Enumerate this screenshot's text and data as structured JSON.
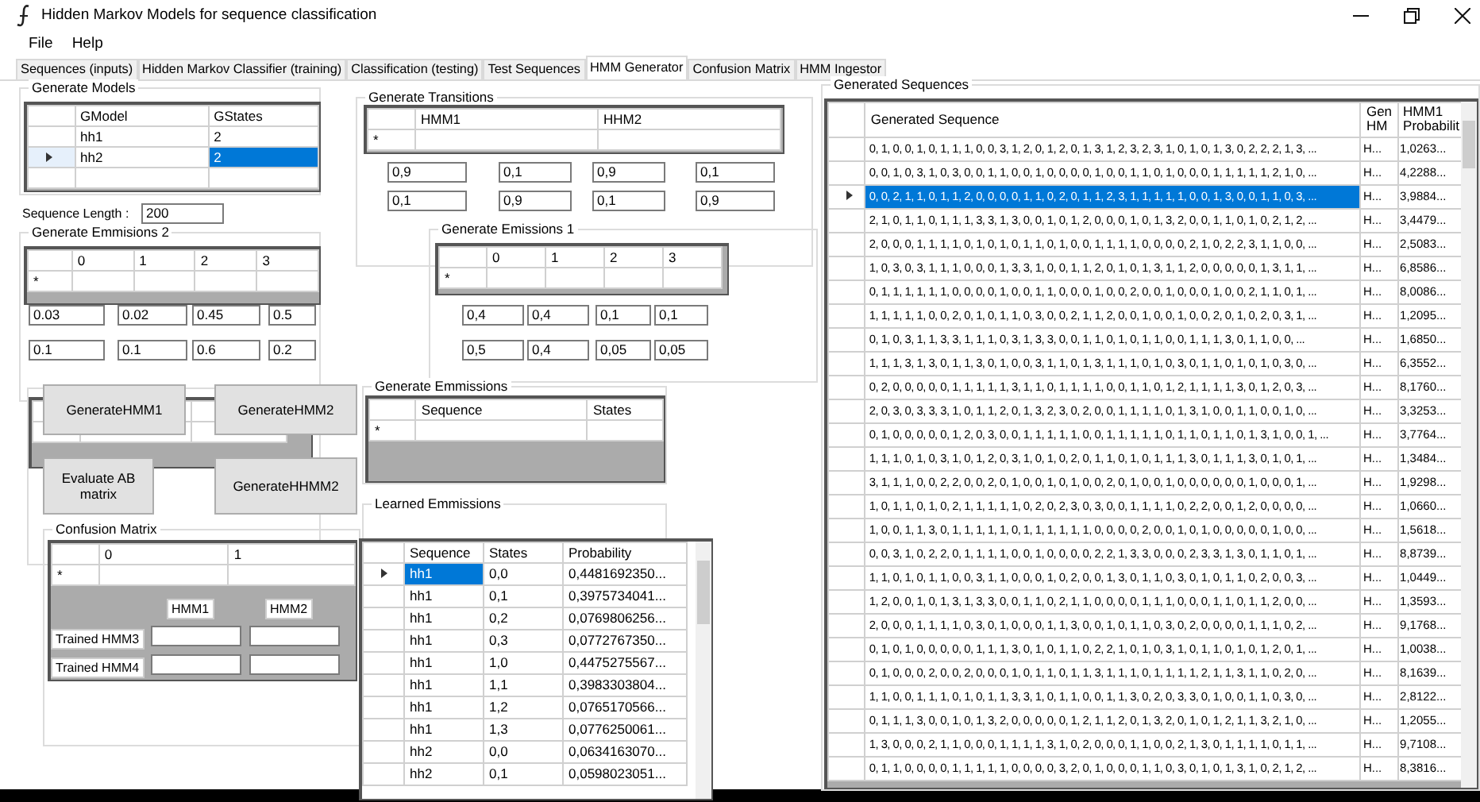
{
  "window": {
    "title": "Hidden Markov Models for sequence classification"
  },
  "menu": [
    "File",
    "Help"
  ],
  "tabs": [
    {
      "label": "Sequences (inputs)",
      "selected": false
    },
    {
      "label": "Hidden Markov Classifier (training)",
      "selected": false
    },
    {
      "label": "Classification (testing)",
      "selected": false
    },
    {
      "label": "Test Sequences",
      "selected": false
    },
    {
      "label": "HMM Generator",
      "selected": true
    },
    {
      "label": "Confusion Matrix",
      "selected": false
    },
    {
      "label": "HMM Ingestor",
      "selected": false
    }
  ],
  "generate_models": {
    "title": "Generate Models",
    "columns": [
      "GModel",
      "GStates"
    ],
    "rows": [
      {
        "cells": [
          "hh1",
          "2"
        ],
        "selected": false
      },
      {
        "cells": [
          "hh2",
          "2"
        ],
        "selected": true
      }
    ]
  },
  "sequence_length": {
    "label": "Sequence Length :",
    "value": "200"
  },
  "generate_emissions_2": {
    "title": "Generate Emmisions 2",
    "columns": [
      "0",
      "1",
      "2",
      "3"
    ],
    "new_row_marker": "*",
    "values": [
      [
        "0.03",
        "0.02",
        "0.45",
        "0.5"
      ],
      [
        "0.1",
        "0.1",
        "0.6",
        "0.2"
      ]
    ]
  },
  "generate_transitions": {
    "title": "Generate Transitions",
    "columns": [
      "HMM1",
      "HHM2"
    ],
    "new_row_marker": "*",
    "values": [
      [
        "0,9",
        "0,1",
        "0,9",
        "0,1"
      ],
      [
        "0,1",
        "0,9",
        "0,1",
        "0,9"
      ]
    ]
  },
  "generate_emissions_1": {
    "title": "Generate Emissions 1",
    "columns": [
      "0",
      "1",
      "2",
      "3"
    ],
    "new_row_marker": "*",
    "values": [
      [
        "0,4",
        "0,4",
        "0,1",
        "0,1"
      ],
      [
        "0,5",
        "0,4",
        "0,05",
        "0,05"
      ]
    ]
  },
  "buttons": [
    {
      "label": "GenerateHMM1"
    },
    {
      "label": "GenerateHMM2"
    },
    {
      "label": "Evaluate AB matrix"
    },
    {
      "label": "GenerateHHMM2"
    }
  ],
  "generate_emissions": {
    "title": "Generate Emmissions",
    "columns": [
      "Sequence",
      "States"
    ],
    "new_row_marker": "*"
  },
  "learned_emissions": {
    "title": "Learned Emmissions",
    "columns": [
      "Sequence",
      "States",
      "Probability"
    ],
    "rows": [
      {
        "cells": [
          "hh1",
          "0,0",
          "0,4481692350..."
        ],
        "selected": true
      },
      {
        "cells": [
          "hh1",
          "0,1",
          "0,3975734041..."
        ],
        "selected": false
      },
      {
        "cells": [
          "hh1",
          "0,2",
          "0,0769806256..."
        ],
        "selected": false
      },
      {
        "cells": [
          "hh1",
          "0,3",
          "0,0772767350..."
        ],
        "selected": false
      },
      {
        "cells": [
          "hh1",
          "1,0",
          "0,4475275567..."
        ],
        "selected": false
      },
      {
        "cells": [
          "hh1",
          "1,1",
          "0,3983303804..."
        ],
        "selected": false
      },
      {
        "cells": [
          "hh1",
          "1,2",
          "0,0765170566..."
        ],
        "selected": false
      },
      {
        "cells": [
          "hh1",
          "1,3",
          "0,0776250061..."
        ],
        "selected": false
      },
      {
        "cells": [
          "hh2",
          "0,0",
          "0,0634163070..."
        ],
        "selected": false
      },
      {
        "cells": [
          "hh2",
          "0,1",
          "0,0598023051..."
        ],
        "selected": false
      }
    ]
  },
  "confusion_matrix": {
    "title": "Confusion Matrix",
    "columns": [
      "0",
      "1"
    ],
    "new_row_marker": "*",
    "column_labels": [
      "HMM1",
      "HMM2"
    ],
    "row_labels": [
      "Trained HMM3",
      "Trained HMM4"
    ]
  },
  "generated_sequences": {
    "title": "Generated Sequences",
    "columns": [
      "Generated Sequence",
      "Gen HM",
      "HMM1 Probabilit"
    ],
    "rows": [
      {
        "sequence": "0, 1, 0, 0, 1, 0, 1, 1, 1, 0, 0, 3, 1, 2, 0, 1, 2, 0, 1, 3, 1, 2, 3, 2, 3, 1, 0, 1, 0, 1, 3, 0, 2, 2, 2, 1, 3, ...",
        "model": "H...",
        "probability": "1,0263...",
        "selected": false
      },
      {
        "sequence": "0, 0, 1, 0, 3, 1, 0, 3, 0, 0, 1, 1, 0, 0, 1, 0, 0, 0, 0, 1, 0, 0, 1, 1, 0, 1, 0, 0, 0, 1, 1, 1, 1, 1, 2, 1, 0, ...",
        "model": "H...",
        "probability": "4,2288...",
        "selected": false
      },
      {
        "sequence": "0, 0, 2, 1, 1, 0, 1, 1, 2, 0, 0, 0, 0, 1, 1, 0, 2, 0, 1, 1, 2, 3, 1, 1, 1, 1, 1, 0, 0, 1, 3, 0, 0, 1, 1, 0, 3, ...",
        "model": "H...",
        "probability": "3,9884...",
        "selected": true
      },
      {
        "sequence": "2, 1, 0, 1, 1, 0, 1, 1, 1, 3, 3, 1, 3, 0, 0, 1, 0, 1, 2, 0, 0, 0, 1, 0, 1, 3, 2, 0, 0, 1, 1, 0, 1, 0, 2, 1, 2, ...",
        "model": "H...",
        "probability": "3,4479...",
        "selected": false
      },
      {
        "sequence": "2, 0, 0, 0, 1, 1, 1, 1, 0, 1, 0, 1, 0, 1, 1, 0, 1, 0, 0, 1, 1, 1, 1, 0, 0, 0, 0, 2, 1, 0, 2, 2, 3, 1, 1, 0, 0, ...",
        "model": "H...",
        "probability": "2,5083...",
        "selected": false
      },
      {
        "sequence": "1, 0, 3, 0, 3, 1, 1, 1, 0, 0, 0, 1, 3, 3, 1, 0, 0, 1, 1, 2, 0, 1, 0, 1, 3, 1, 1, 2, 0, 0, 0, 0, 0, 1, 3, 1, 1, ...",
        "model": "H...",
        "probability": "6,8586...",
        "selected": false
      },
      {
        "sequence": "0, 1, 1, 1, 1, 1, 1, 0, 0, 0, 0, 1, 0, 0, 1, 1, 0, 0, 0, 1, 0, 0, 2, 0, 0, 1, 0, 0, 0, 1, 0, 0, 2, 1, 1, 0, 1, ...",
        "model": "H...",
        "probability": "8,0086...",
        "selected": false
      },
      {
        "sequence": "1, 1, 1, 1, 1, 0, 0, 2, 0, 1, 0, 1, 1, 0, 3, 0, 0, 2, 1, 1, 2, 0, 0, 1, 0, 0, 1, 0, 0, 2, 0, 1, 0, 2, 0, 3, 1, ...",
        "model": "H...",
        "probability": "1,2095...",
        "selected": false
      },
      {
        "sequence": "0, 1, 0, 3, 1, 1, 3, 3, 1, 1, 1, 0, 3, 1, 3, 3, 0, 0, 1, 1, 0, 1, 0, 1, 1, 0, 0, 1, 1, 1, 3, 0, 1, 1, 0, 0, ...",
        "model": "H...",
        "probability": "1,6850...",
        "selected": false
      },
      {
        "sequence": "1, 1, 1, 3, 1, 3, 0, 1, 1, 3, 0, 1, 0, 0, 3, 1, 1, 0, 1, 3, 1, 1, 1, 0, 1, 0, 3, 0, 1, 1, 0, 1, 0, 1, 0, 3, 0, ...",
        "model": "H...",
        "probability": "6,3552...",
        "selected": false
      },
      {
        "sequence": "0, 2, 0, 0, 0, 0, 0, 1, 1, 1, 1, 1, 3, 1, 1, 0, 1, 1, 1, 1, 0, 0, 1, 1, 0, 1, 2, 1, 1, 1, 1, 3, 0, 1, 2, 0, 3, ...",
        "model": "H...",
        "probability": "8,1760...",
        "selected": false
      },
      {
        "sequence": "2, 0, 3, 0, 3, 3, 3, 1, 0, 1, 1, 2, 0, 1, 3, 2, 3, 0, 2, 0, 0, 1, 1, 1, 1, 0, 1, 3, 1, 0, 0, 1, 1, 0, 0, 1, 0, ...",
        "model": "H...",
        "probability": "3,3253...",
        "selected": false
      },
      {
        "sequence": "0, 1, 0, 0, 0, 0, 0, 1, 2, 0, 3, 0, 0, 1, 1, 1, 1, 1, 0, 0, 1, 1, 1, 1, 1, 0, 1, 1, 0, 1, 1, 0, 1, 3, 1, 0, 0, 1, ...",
        "model": "H...",
        "probability": "3,7764...",
        "selected": false
      },
      {
        "sequence": "1, 1, 1, 0, 1, 0, 3, 1, 0, 1, 2, 0, 3, 1, 0, 1, 0, 2, 0, 1, 1, 0, 1, 0, 1, 1, 1, 3, 0, 1, 1, 1, 3, 0, 1, 0, 1, ...",
        "model": "H...",
        "probability": "1,3484...",
        "selected": false
      },
      {
        "sequence": "3, 1, 1, 1, 0, 0, 2, 2, 0, 0, 2, 0, 1, 0, 0, 1, 0, 1, 0, 0, 2, 0, 1, 0, 0, 1, 0, 0, 0, 0, 0, 0, 1, 0, 0, 0, 1, ...",
        "model": "H...",
        "probability": "1,9298...",
        "selected": false
      },
      {
        "sequence": "1, 0, 1, 1, 0, 1, 0, 2, 1, 1, 1, 1, 1, 0, 2, 0, 2, 3, 0, 3, 0, 0, 1, 1, 1, 1, 0, 2, 2, 0, 0, 1, 2, 0, 0, 0, 0, ...",
        "model": "H...",
        "probability": "1,0660...",
        "selected": false
      },
      {
        "sequence": "1, 0, 0, 1, 1, 3, 0, 1, 1, 1, 1, 1, 0, 1, 1, 1, 1, 1, 1, 0, 0, 0, 0, 2, 0, 0, 1, 0, 1, 0, 0, 0, 0, 0, 1, 0, 0, ...",
        "model": "H...",
        "probability": "1,5618...",
        "selected": false
      },
      {
        "sequence": "0, 0, 3, 1, 0, 2, 2, 0, 1, 1, 1, 1, 0, 0, 1, 0, 0, 0, 0, 2, 2, 1, 3, 3, 0, 0, 0, 2, 3, 3, 1, 3, 0, 1, 1, 0, 1, ...",
        "model": "H...",
        "probability": "8,8739...",
        "selected": false
      },
      {
        "sequence": "1, 1, 0, 1, 0, 1, 1, 0, 0, 3, 1, 1, 0, 0, 0, 1, 0, 2, 0, 0, 1, 3, 0, 1, 1, 0, 3, 0, 1, 0, 1, 1, 0, 2, 0, 0, 3, ...",
        "model": "H...",
        "probability": "1,0449...",
        "selected": false
      },
      {
        "sequence": "1, 2, 0, 0, 1, 0, 1, 3, 1, 3, 3, 0, 0, 1, 1, 0, 2, 1, 1, 0, 0, 0, 0, 1, 1, 1, 0, 0, 0, 1, 1, 0, 1, 1, 2, 0, 0, ...",
        "model": "H...",
        "probability": "1,3593...",
        "selected": false
      },
      {
        "sequence": "2, 0, 0, 0, 1, 1, 1, 1, 0, 3, 0, 1, 0, 0, 0, 1, 1, 3, 0, 0, 1, 0, 1, 1, 0, 3, 0, 2, 0, 0, 0, 0, 1, 1, 1, 0, 2, ...",
        "model": "H...",
        "probability": "9,1768...",
        "selected": false
      },
      {
        "sequence": "0, 1, 0, 1, 0, 0, 0, 0, 0, 1, 1, 1, 3, 0, 1, 0, 1, 1, 0, 2, 2, 1, 0, 1, 0, 3, 1, 0, 1, 1, 0, 1, 0, 1, 2, 0, 1, ...",
        "model": "H...",
        "probability": "1,0038...",
        "selected": false
      },
      {
        "sequence": "0, 1, 0, 0, 0, 2, 0, 0, 2, 0, 0, 0, 1, 0, 1, 1, 0, 1, 1, 3, 1, 1, 1, 0, 1, 1, 1, 1, 2, 1, 1, 3, 1, 1, 0, 2, 0, ...",
        "model": "H...",
        "probability": "8,1639...",
        "selected": false
      },
      {
        "sequence": "1, 1, 0, 0, 1, 1, 1, 0, 1, 0, 1, 1, 3, 3, 1, 0, 1, 1, 0, 0, 1, 1, 3, 0, 2, 0, 3, 3, 0, 1, 0, 0, 1, 1, 0, 3, 0, ...",
        "model": "H...",
        "probability": "2,8122...",
        "selected": false
      },
      {
        "sequence": "0, 1, 1, 1, 3, 0, 0, 1, 0, 1, 3, 2, 0, 0, 0, 0, 0, 1, 2, 1, 1, 2, 0, 1, 3, 2, 0, 1, 0, 1, 2, 1, 1, 3, 2, 1, 0, ...",
        "model": "H...",
        "probability": "1,2055...",
        "selected": false
      },
      {
        "sequence": "1, 3, 0, 0, 0, 2, 1, 1, 0, 0, 0, 1, 1, 1, 1, 3, 1, 0, 2, 0, 0, 0, 1, 1, 0, 0, 2, 1, 3, 0, 1, 1, 1, 1, 0, 1, 1, ...",
        "model": "H...",
        "probability": "9,7108...",
        "selected": false
      },
      {
        "sequence": "0, 1, 1, 0, 0, 0, 0, 1, 1, 1, 1, 1, 0, 0, 0, 0, 3, 2, 0, 1, 0, 0, 0, 1, 1, 0, 3, 0, 1, 0, 1, 3, 1, 0, 2, 1, 2, ...",
        "model": "H...",
        "probability": "8,3816...",
        "selected": false
      }
    ]
  }
}
